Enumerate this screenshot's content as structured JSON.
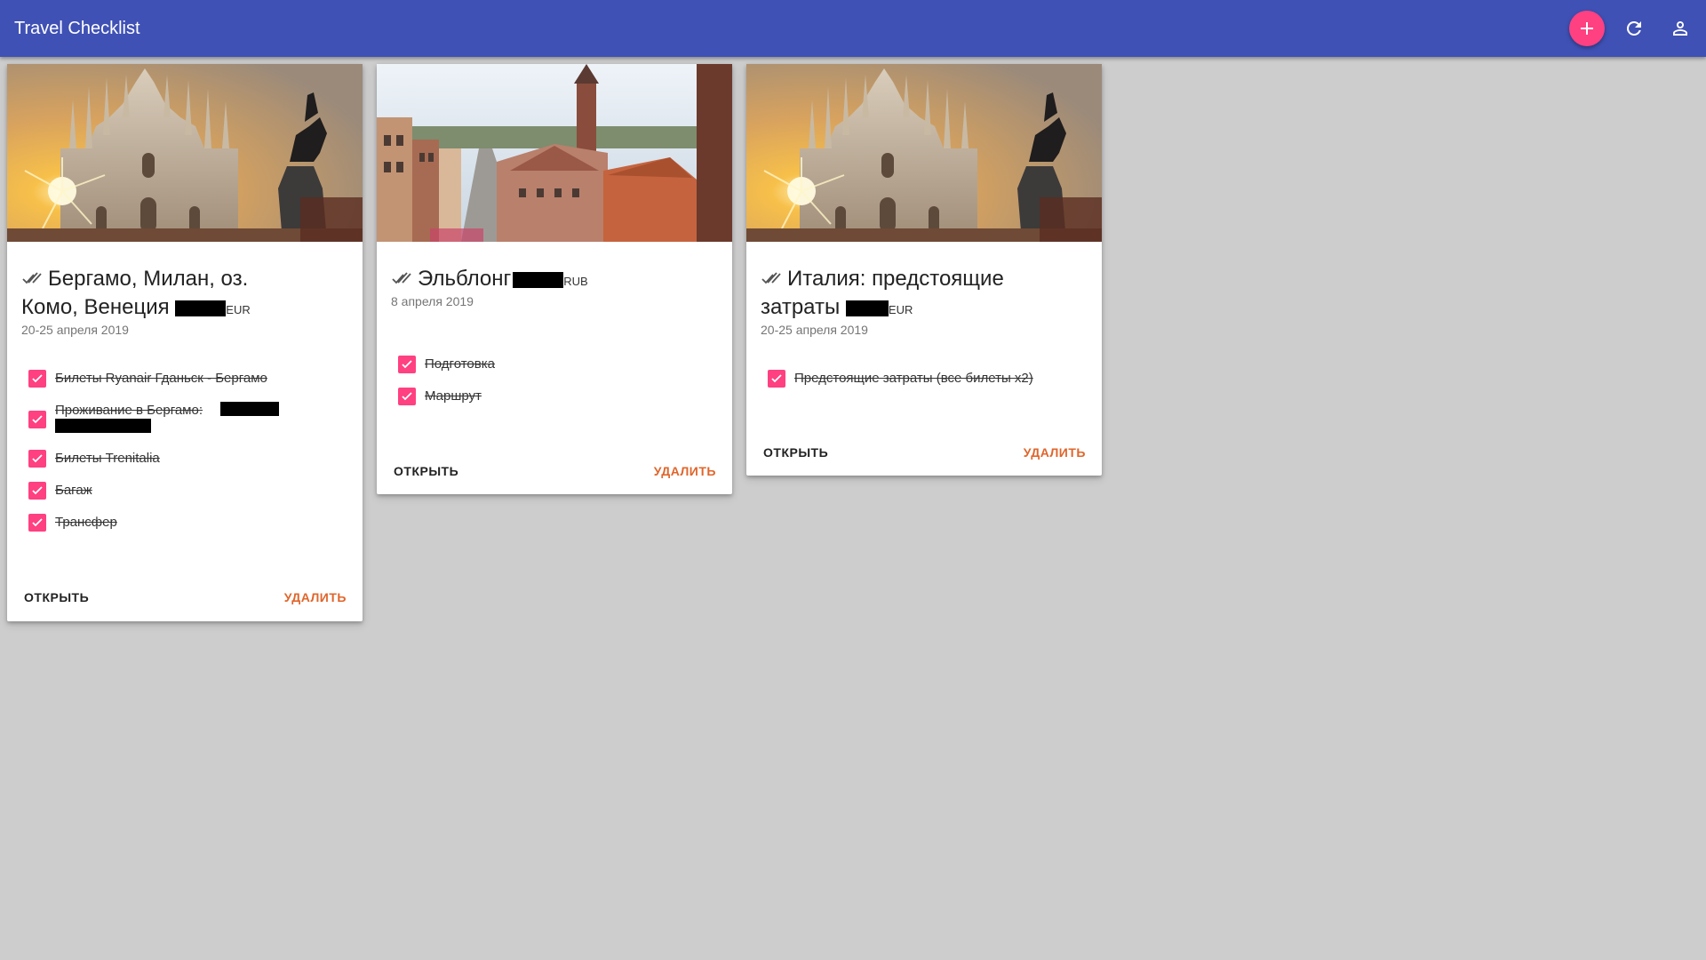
{
  "header": {
    "title": "Travel Checklist",
    "add_icon": "plus-icon",
    "refresh_icon": "refresh-icon",
    "account_icon": "person-icon",
    "accent_color": "#3f51b5",
    "fab_color": "#ff4081"
  },
  "cards": [
    {
      "image": "milan-cathedral-sunset",
      "title_line1": "Бергамо, Милан, оз.",
      "title_line2": "Комо, Венеция",
      "currency": "EUR",
      "date": "20-25 апреля 2019",
      "items": [
        {
          "label": "Билеты Ryanair Гданьск - Бергамо",
          "checked": true
        },
        {
          "label": "Проживание в Бергамо:",
          "checked": true
        },
        {
          "label": "Билеты Trenitalia",
          "checked": true
        },
        {
          "label": "Багаж",
          "checked": true
        },
        {
          "label": "Трансфер",
          "checked": true
        }
      ],
      "open_label": "ОТКРЫТЬ",
      "delete_label": "УДАЛИТЬ"
    },
    {
      "image": "elblag-old-town-street",
      "title_line1": "Эльблонг",
      "currency": "RUB",
      "date": "8 апреля 2019",
      "items": [
        {
          "label": "Подготовка",
          "checked": true
        },
        {
          "label": "Маршрут",
          "checked": true
        }
      ],
      "open_label": "ОТКРЫТЬ",
      "delete_label": "УДАЛИТЬ"
    },
    {
      "image": "milan-cathedral-sunset",
      "title_line1": "Италия: предстоящие",
      "title_line2": "затраты",
      "currency": "EUR",
      "date": "20-25 апреля 2019",
      "items": [
        {
          "label": "Предстоящие затраты (все билеты x2)",
          "checked": true
        }
      ],
      "open_label": "ОТКРЫТЬ",
      "delete_label": "УДАЛИТЬ"
    }
  ],
  "colors": {
    "checkbox": "#ff4081",
    "delete": "#e0652b",
    "background": "#cdcdcd"
  }
}
